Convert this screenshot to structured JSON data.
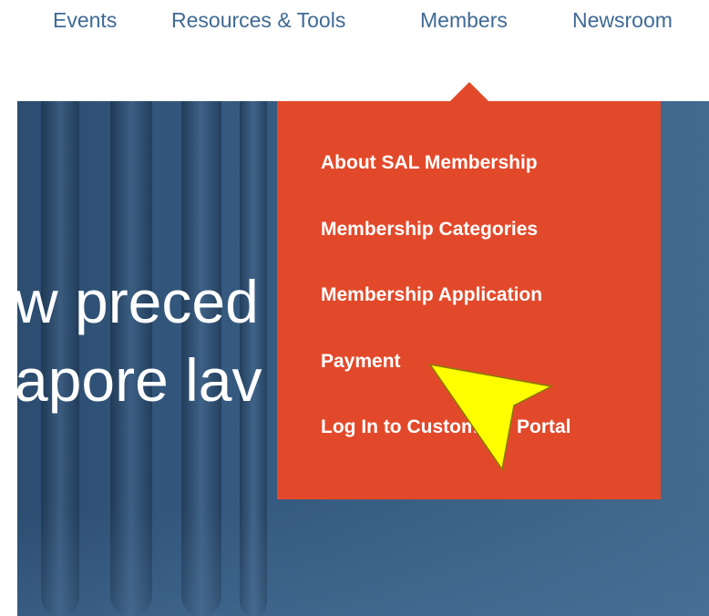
{
  "nav": {
    "items": [
      {
        "label": "Events"
      },
      {
        "label": "Resources & Tools"
      },
      {
        "label": "Members"
      },
      {
        "label": "Newsroom"
      }
    ]
  },
  "hero": {
    "line1": "w preced",
    "line2": "apore lav"
  },
  "dropdown": {
    "items": [
      {
        "label": "About SAL Membership"
      },
      {
        "label": "Membership Categories"
      },
      {
        "label": "Membership Application"
      },
      {
        "label": "Payment"
      },
      {
        "label": "Log In to Customers' Portal"
      }
    ]
  },
  "colors": {
    "nav_text": "#3f6a95",
    "dropdown_bg": "#e2492a",
    "hero_bg": "#35597f",
    "arrow_fill": "#ffff00"
  },
  "icons": {
    "pointer": "arrow-pointer-icon"
  }
}
